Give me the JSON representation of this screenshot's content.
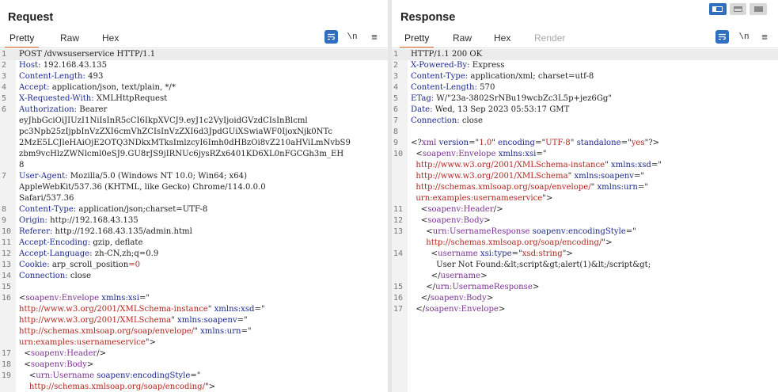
{
  "request": {
    "title": "Request",
    "tabs": [
      "Pretty",
      "Raw",
      "Hex"
    ],
    "active_tab": "Pretty",
    "lines": [
      {
        "n": "1",
        "hl": true,
        "segs": [
          [
            "plain",
            "POST /dvwsuserservice HTTP/1.1"
          ]
        ]
      },
      {
        "n": "2",
        "segs": [
          [
            "key",
            "Host: "
          ],
          [
            "val",
            "192.168.43.135"
          ]
        ]
      },
      {
        "n": "3",
        "segs": [
          [
            "key",
            "Content-Length: "
          ],
          [
            "val",
            "493"
          ]
        ]
      },
      {
        "n": "4",
        "segs": [
          [
            "key",
            "Accept: "
          ],
          [
            "val",
            "application/json, text/plain, */*"
          ]
        ]
      },
      {
        "n": "5",
        "segs": [
          [
            "key",
            "X-Requested-With: "
          ],
          [
            "val",
            "XMLHttpRequest"
          ]
        ]
      },
      {
        "n": "6",
        "segs": [
          [
            "key",
            "Authorization: "
          ],
          [
            "val",
            "Bearer"
          ]
        ]
      },
      {
        "n": "",
        "segs": [
          [
            "val",
            "eyJhbGciOiJIUzI1NiIsInR5cCI6IkpXVCJ9.eyJ1c2VyIjoidGVzdCIsInBlcml"
          ]
        ]
      },
      {
        "n": "",
        "segs": [
          [
            "val",
            "pc3Npb25zIjpbInVzZXI6cmVhZCIsInVzZXI6d3JpdGUiXSwiaWF0IjoxNjk0NTc"
          ]
        ]
      },
      {
        "n": "",
        "segs": [
          [
            "val",
            "2MzE5LCJleHAiOjE2OTQ3NDkxMTksImlzcyI6Imh0dHBzOi8vZ210aHViLmNvbS9"
          ]
        ]
      },
      {
        "n": "",
        "segs": [
          [
            "val",
            "zbm9vcHlzZWNlcml0eSJ9.GU8rJS9jIRNUc6jysRZx6401KD6XL0nFGCGh3m_EH"
          ]
        ]
      },
      {
        "n": "",
        "segs": [
          [
            "val",
            "8"
          ]
        ]
      },
      {
        "n": "7",
        "segs": [
          [
            "key",
            "User-Agent: "
          ],
          [
            "val",
            "Mozilla/5.0 (Windows NT 10.0; Win64; x64)"
          ]
        ]
      },
      {
        "n": "",
        "segs": [
          [
            "val",
            "AppleWebKit/537.36 (KHTML, like Gecko) Chrome/114.0.0.0"
          ]
        ]
      },
      {
        "n": "",
        "segs": [
          [
            "val",
            "Safari/537.36"
          ]
        ]
      },
      {
        "n": "8",
        "segs": [
          [
            "key",
            "Content-Type: "
          ],
          [
            "val",
            "application/json;charset=UTF-8"
          ]
        ]
      },
      {
        "n": "9",
        "segs": [
          [
            "key",
            "Origin: "
          ],
          [
            "val",
            "http://192.168.43.135"
          ]
        ]
      },
      {
        "n": "10",
        "segs": [
          [
            "key",
            "Referer: "
          ],
          [
            "val",
            "http://192.168.43.135/admin.html"
          ]
        ]
      },
      {
        "n": "11",
        "segs": [
          [
            "key",
            "Accept-Encoding: "
          ],
          [
            "val",
            "gzip, deflate"
          ]
        ]
      },
      {
        "n": "12",
        "segs": [
          [
            "key",
            "Accept-Language: "
          ],
          [
            "val",
            "zh-CN,zh;q=0.9"
          ]
        ]
      },
      {
        "n": "13",
        "segs": [
          [
            "key",
            "Cookie: "
          ],
          [
            "val",
            "arp_scroll_position"
          ],
          [
            "str",
            "=0"
          ]
        ]
      },
      {
        "n": "14",
        "segs": [
          [
            "key",
            "Connection: "
          ],
          [
            "val",
            "close"
          ]
        ]
      },
      {
        "n": "15",
        "segs": []
      },
      {
        "n": "16",
        "segs": [
          [
            "plain",
            "<"
          ],
          [
            "tag",
            "soapenv:Envelope"
          ],
          [
            "attr",
            " xmlns:xsi"
          ],
          [
            "plain",
            "=\""
          ]
        ]
      },
      {
        "n": "",
        "segs": [
          [
            "str",
            "http://www.w3.org/2001/XMLSchema-instance"
          ],
          [
            "plain",
            "\""
          ],
          [
            "attr",
            " xmlns:xsd"
          ],
          [
            "plain",
            "=\""
          ]
        ]
      },
      {
        "n": "",
        "segs": [
          [
            "str",
            "http://www.w3.org/2001/XMLSchema"
          ],
          [
            "plain",
            "\""
          ],
          [
            "attr",
            " xmlns:soapenv"
          ],
          [
            "plain",
            "=\""
          ]
        ]
      },
      {
        "n": "",
        "segs": [
          [
            "str",
            "http://schemas.xmlsoap.org/soap/envelope/"
          ],
          [
            "plain",
            "\""
          ],
          [
            "attr",
            " xmlns:urn"
          ],
          [
            "plain",
            "=\""
          ]
        ]
      },
      {
        "n": "",
        "segs": [
          [
            "str",
            "urn:examples:usernameservice"
          ],
          [
            "plain",
            "\">"
          ]
        ]
      },
      {
        "n": "17",
        "segs": [
          [
            "plain",
            "  <"
          ],
          [
            "tag",
            "soapenv:Header"
          ],
          [
            "plain",
            "/>"
          ]
        ]
      },
      {
        "n": "18",
        "segs": [
          [
            "plain",
            "  <"
          ],
          [
            "tag",
            "soapenv:Body"
          ],
          [
            "plain",
            ">"
          ]
        ]
      },
      {
        "n": "19",
        "segs": [
          [
            "plain",
            "    <"
          ],
          [
            "tag",
            "urn:Username"
          ],
          [
            "attr",
            " soapenv:encodingStyle"
          ],
          [
            "plain",
            "=\""
          ]
        ]
      },
      {
        "n": "",
        "segs": [
          [
            "str",
            "    http://schemas.xmlsoap.org/soap/encoding/"
          ],
          [
            "plain",
            "\">"
          ]
        ]
      }
    ]
  },
  "response": {
    "title": "Response",
    "tabs": [
      "Pretty",
      "Raw",
      "Hex",
      "Render"
    ],
    "active_tab": "Pretty",
    "lines": [
      {
        "n": "1",
        "hl": true,
        "segs": [
          [
            "plain",
            "HTTP/1.1 200 OK"
          ]
        ]
      },
      {
        "n": "2",
        "segs": [
          [
            "key",
            "X-Powered-By: "
          ],
          [
            "val",
            "Express"
          ]
        ]
      },
      {
        "n": "3",
        "segs": [
          [
            "key",
            "Content-Type: "
          ],
          [
            "val",
            "application/xml; charset=utf-8"
          ]
        ]
      },
      {
        "n": "4",
        "segs": [
          [
            "key",
            "Content-Length: "
          ],
          [
            "val",
            "570"
          ]
        ]
      },
      {
        "n": "5",
        "segs": [
          [
            "key",
            "ETag: "
          ],
          [
            "val",
            "W/\"23a-3802SrNBu19wcbZc3L5p+jez6Gg\""
          ]
        ]
      },
      {
        "n": "6",
        "segs": [
          [
            "key",
            "Date: "
          ],
          [
            "val",
            "Wed, 13 Sep 2023 05:53:17 GMT"
          ]
        ]
      },
      {
        "n": "7",
        "segs": [
          [
            "key",
            "Connection: "
          ],
          [
            "val",
            "close"
          ]
        ]
      },
      {
        "n": "8",
        "segs": []
      },
      {
        "n": "9",
        "segs": [
          [
            "plain",
            "<?"
          ],
          [
            "tag",
            "xml"
          ],
          [
            "attr",
            " version"
          ],
          [
            "plain",
            "=\""
          ],
          [
            "str",
            "1.0"
          ],
          [
            "plain",
            "\""
          ],
          [
            "attr",
            " encoding"
          ],
          [
            "plain",
            "=\""
          ],
          [
            "str",
            "UTF-8"
          ],
          [
            "plain",
            "\""
          ],
          [
            "attr",
            " standalone"
          ],
          [
            "plain",
            "=\""
          ],
          [
            "str",
            "yes"
          ],
          [
            "plain",
            "\"?>"
          ]
        ]
      },
      {
        "n": "10",
        "segs": [
          [
            "plain",
            "  <"
          ],
          [
            "tag",
            "soapenv:Envelope"
          ],
          [
            "attr",
            " xmlns:xsi"
          ],
          [
            "plain",
            "=\""
          ]
        ]
      },
      {
        "n": "",
        "segs": [
          [
            "str",
            "  http://www.w3.org/2001/XMLSchema-instance"
          ],
          [
            "plain",
            "\""
          ],
          [
            "attr",
            " xmlns:xsd"
          ],
          [
            "plain",
            "=\""
          ]
        ]
      },
      {
        "n": "",
        "segs": [
          [
            "str",
            "  http://www.w3.org/2001/XMLSchema"
          ],
          [
            "plain",
            "\""
          ],
          [
            "attr",
            " xmlns:soapenv"
          ],
          [
            "plain",
            "=\""
          ]
        ]
      },
      {
        "n": "",
        "segs": [
          [
            "str",
            "  http://schemas.xmlsoap.org/soap/envelope/"
          ],
          [
            "plain",
            "\""
          ],
          [
            "attr",
            " xmlns:urn"
          ],
          [
            "plain",
            "=\""
          ]
        ]
      },
      {
        "n": "",
        "segs": [
          [
            "str",
            "  urn:examples:usernameservice"
          ],
          [
            "plain",
            "\">"
          ]
        ]
      },
      {
        "n": "11",
        "segs": [
          [
            "plain",
            "    <"
          ],
          [
            "tag",
            "soapenv:Header"
          ],
          [
            "plain",
            "/>"
          ]
        ]
      },
      {
        "n": "12",
        "segs": [
          [
            "plain",
            "    <"
          ],
          [
            "tag",
            "soapenv:Body"
          ],
          [
            "plain",
            ">"
          ]
        ]
      },
      {
        "n": "13",
        "segs": [
          [
            "plain",
            "      <"
          ],
          [
            "tag",
            "urn:UsernameResponse"
          ],
          [
            "attr",
            " soapenv:encodingStyle"
          ],
          [
            "plain",
            "=\""
          ]
        ]
      },
      {
        "n": "",
        "segs": [
          [
            "str",
            "      http://schemas.xmlsoap.org/soap/encoding/"
          ],
          [
            "plain",
            "\">"
          ]
        ]
      },
      {
        "n": "14",
        "segs": [
          [
            "plain",
            "        <"
          ],
          [
            "tag",
            "username"
          ],
          [
            "attr",
            " xsi:type"
          ],
          [
            "plain",
            "=\""
          ],
          [
            "str",
            "xsd:string"
          ],
          [
            "plain",
            "\">"
          ]
        ]
      },
      {
        "n": "",
        "segs": [
          [
            "plain",
            "          User Not Found:&lt;script&gt;alert(1)&lt;/script&gt;"
          ]
        ]
      },
      {
        "n": "",
        "segs": [
          [
            "plain",
            "        </"
          ],
          [
            "tag",
            "username"
          ],
          [
            "plain",
            ">"
          ]
        ]
      },
      {
        "n": "15",
        "segs": [
          [
            "plain",
            "      </"
          ],
          [
            "tag",
            "urn:UsernameResponse"
          ],
          [
            "plain",
            ">"
          ]
        ]
      },
      {
        "n": "16",
        "segs": [
          [
            "plain",
            "    </"
          ],
          [
            "tag",
            "soapenv:Body"
          ],
          [
            "plain",
            ">"
          ]
        ]
      },
      {
        "n": "17",
        "segs": [
          [
            "plain",
            "  </"
          ],
          [
            "tag",
            "soapenv:Envelope"
          ],
          [
            "plain",
            ">"
          ]
        ]
      }
    ]
  },
  "icons": {
    "wrap": "word-wrap-icon",
    "newline": "\\n",
    "menu": "menu-icon",
    "layout_split": "split-view-icon",
    "layout_horizontal": "horizontal-layout-icon",
    "layout_single": "single-pane-icon"
  },
  "colors": {
    "accent": "#e8692a",
    "toolbar_blue": "#2e6fbf",
    "key": "#1d2a8f",
    "tag": "#7c3294",
    "string": "#b3261e"
  }
}
